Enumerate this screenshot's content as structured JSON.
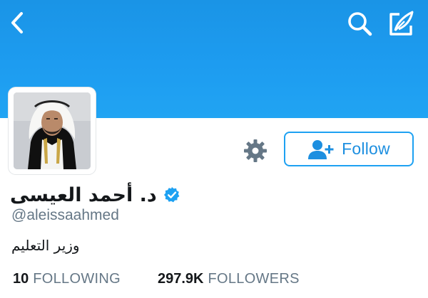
{
  "header": {
    "back_icon": "chevron-left-icon",
    "search_icon": "search-icon",
    "compose_icon": "compose-tweet-icon",
    "background_color": "#1d9cf0",
    "icon_color": "#ffffff"
  },
  "profile": {
    "display_name": "د. أحمد العيسى",
    "verified": true,
    "verified_color": "#1da1f2",
    "handle": "@aleissaahmed",
    "bio": "وزير التعليم",
    "avatar_icon": "profile-photo"
  },
  "actions": {
    "settings_icon": "gear-icon",
    "follow_label": "Follow",
    "follow_icon": "add-user-icon",
    "accent_color": "#1da1f2"
  },
  "stats": {
    "following_count": "10",
    "following_label": "FOLLOWING",
    "followers_count": "297.9K",
    "followers_label": "FOLLOWERS"
  }
}
